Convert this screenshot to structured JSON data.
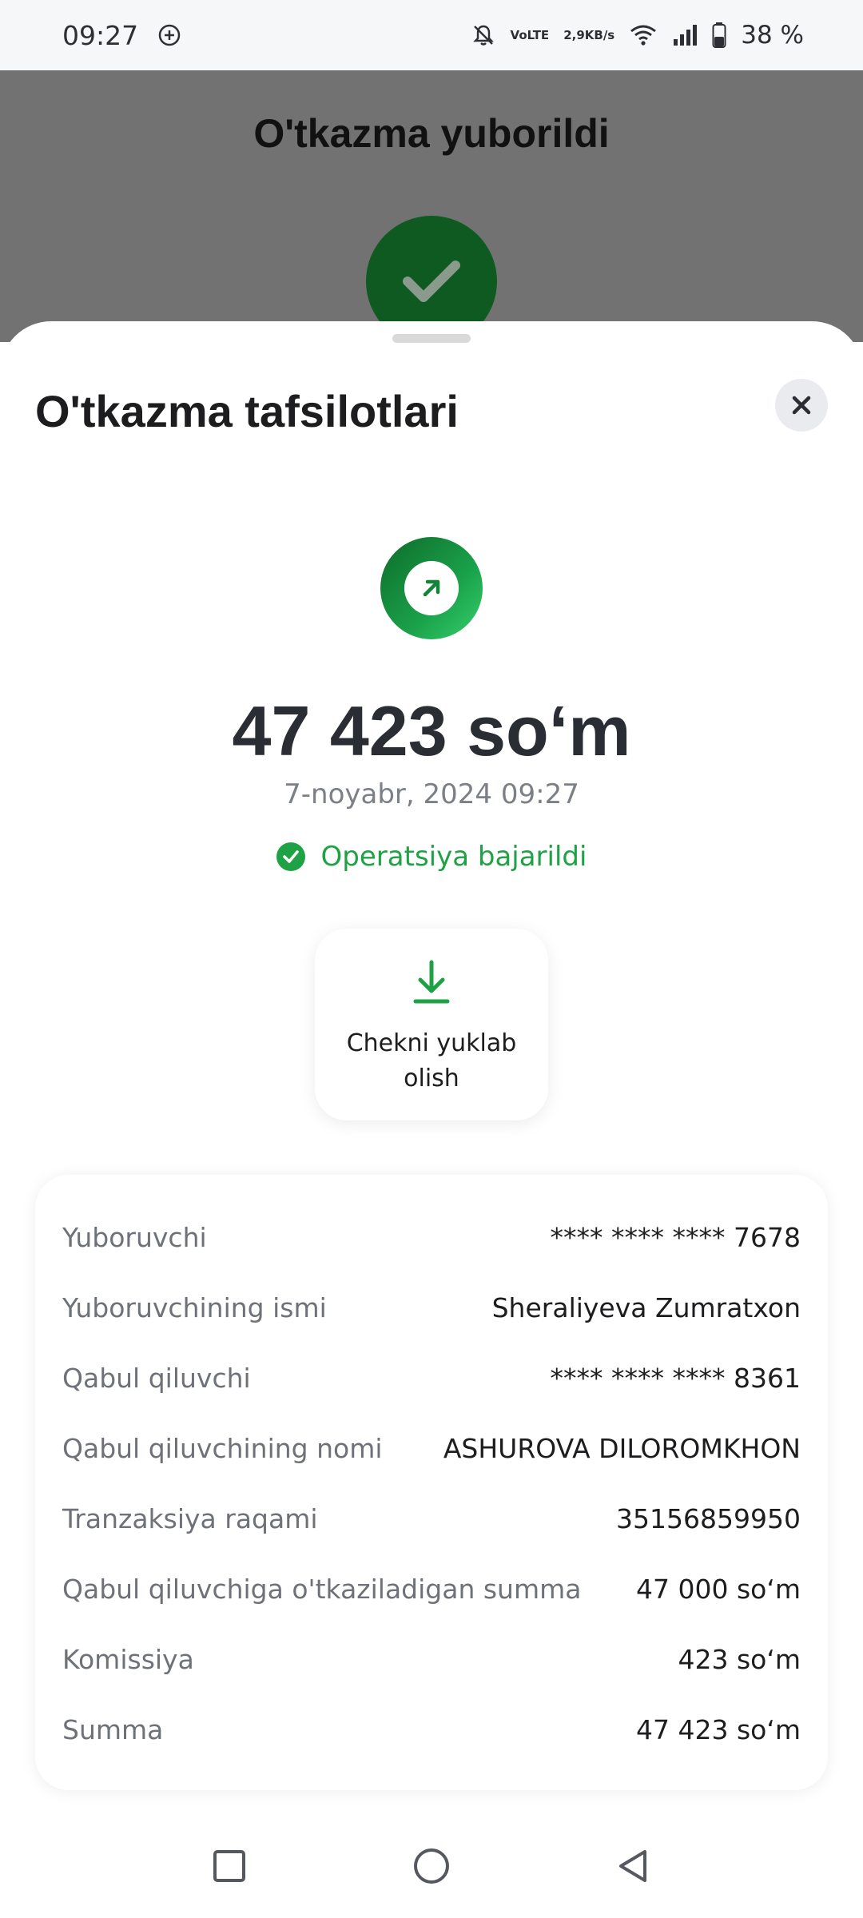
{
  "status_bar": {
    "time": "09:27",
    "network_speed_value": "2,9",
    "network_speed_unit": "KB/s",
    "volte_label": "VoLTE",
    "battery": "38 %"
  },
  "background": {
    "title": "O'tkazma yuborildi"
  },
  "sheet": {
    "title": "O'tkazma tafsilotlari",
    "amount": "47 423 so‘m",
    "datetime": "7-noyabr, 2024 09:27",
    "status_text": "Operatsiya bajarildi",
    "download_label_line1": "Chekni yuklab",
    "download_label_line2": "olish"
  },
  "details": [
    {
      "label": "Yuboruvchi",
      "value": "**** **** **** 7678"
    },
    {
      "label": "Yuboruvchining ismi",
      "value": "Sheraliyeva Zumratxon"
    },
    {
      "label": "Qabul qiluvchi",
      "value": "**** **** **** 8361"
    },
    {
      "label": "Qabul qiluvchining nomi",
      "value": "ASHUROVA DILOROMKHON"
    },
    {
      "label": "Tranzaksiya raqami",
      "value": "35156859950"
    },
    {
      "label": "Qabul qiluvchiga o'tkaziladigan summa",
      "value": "47 000 so‘m"
    },
    {
      "label": "Komissiya",
      "value": "423 so‘m"
    },
    {
      "label": "Summa",
      "value": "47 423 so‘m"
    }
  ],
  "colors": {
    "accent_green": "#1fa245",
    "dark_green": "#0f5a21",
    "overlay_gray": "#727272"
  },
  "icons": {
    "status_extra": "plus-circle-icon",
    "mute": "bell-off-icon",
    "wifi": "wifi-icon",
    "signal": "signal-icon",
    "battery": "battery-icon",
    "success": "check-icon",
    "close": "close-icon",
    "transfer": "arrow-up-right-icon",
    "download": "download-icon",
    "nav_recent": "square-icon",
    "nav_home": "circle-icon",
    "nav_back": "triangle-back-icon"
  }
}
